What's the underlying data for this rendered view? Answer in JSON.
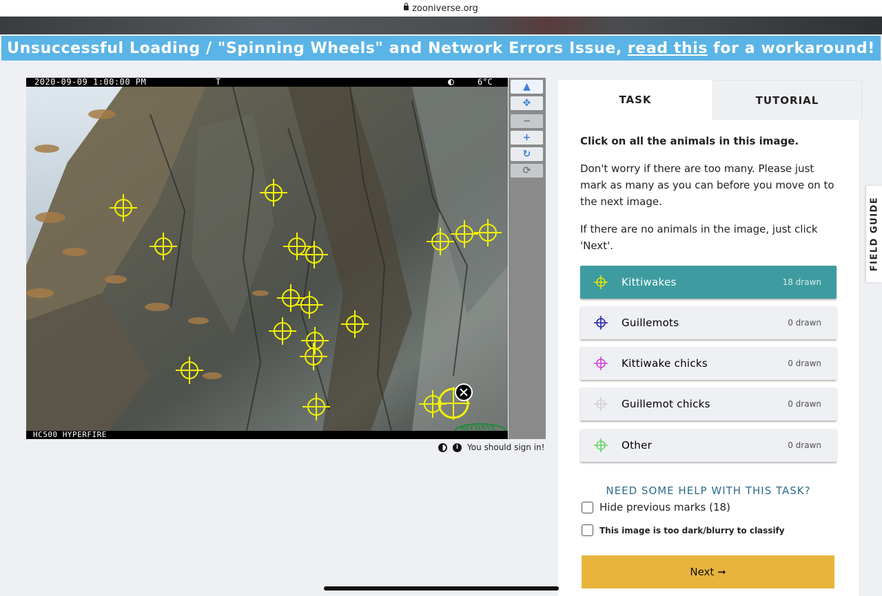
{
  "browser": {
    "url": "zooniverse.org"
  },
  "banner": {
    "text_before": "Unsuccessful Loading / \"Spinning Wheels\" and Network Errors Issue,",
    "link_text": "read this",
    "text_after": "for a workaround!"
  },
  "camera": {
    "datetime": "2020-09-09 1:00:00 PM",
    "mode": "T",
    "temperature": "6°C",
    "model": "HC500 HYPERFIRE",
    "brand": "RECONYX"
  },
  "viewer_footer": {
    "sign_in_text": "You should sign in!"
  },
  "tabs": {
    "task": "TASK",
    "tutorial": "TUTORIAL"
  },
  "task": {
    "heading": "Click on all the animals in this image.",
    "paragraph1": "Don't worry if there are too many. Please just mark as many as you can before you move on to the next image.",
    "paragraph2": "If there are no animals in the image, just click 'Next'.",
    "choices": [
      {
        "label": "Kittiwakes",
        "count": "18 drawn",
        "color": "#e6e600",
        "selected": true
      },
      {
        "label": "Guillemots",
        "count": "0 drawn",
        "color": "#1a1aa8",
        "selected": false
      },
      {
        "label": "Kittiwake chicks",
        "count": "0 drawn",
        "color": "#d23ad6",
        "selected": false
      },
      {
        "label": "Guillemot chicks",
        "count": "0 drawn",
        "color": "#cfcfcf",
        "selected": false
      },
      {
        "label": "Other",
        "count": "0 drawn",
        "color": "#5fd45f",
        "selected": false
      }
    ],
    "help_link": "NEED SOME HELP WITH THIS TASK?",
    "hide_marks_label": "Hide previous marks (18)",
    "too_dark_label": "This image is too dark/blurry to classify",
    "next_label": "Next ➞"
  },
  "field_guide": {
    "label": "FIELD GUIDE"
  }
}
